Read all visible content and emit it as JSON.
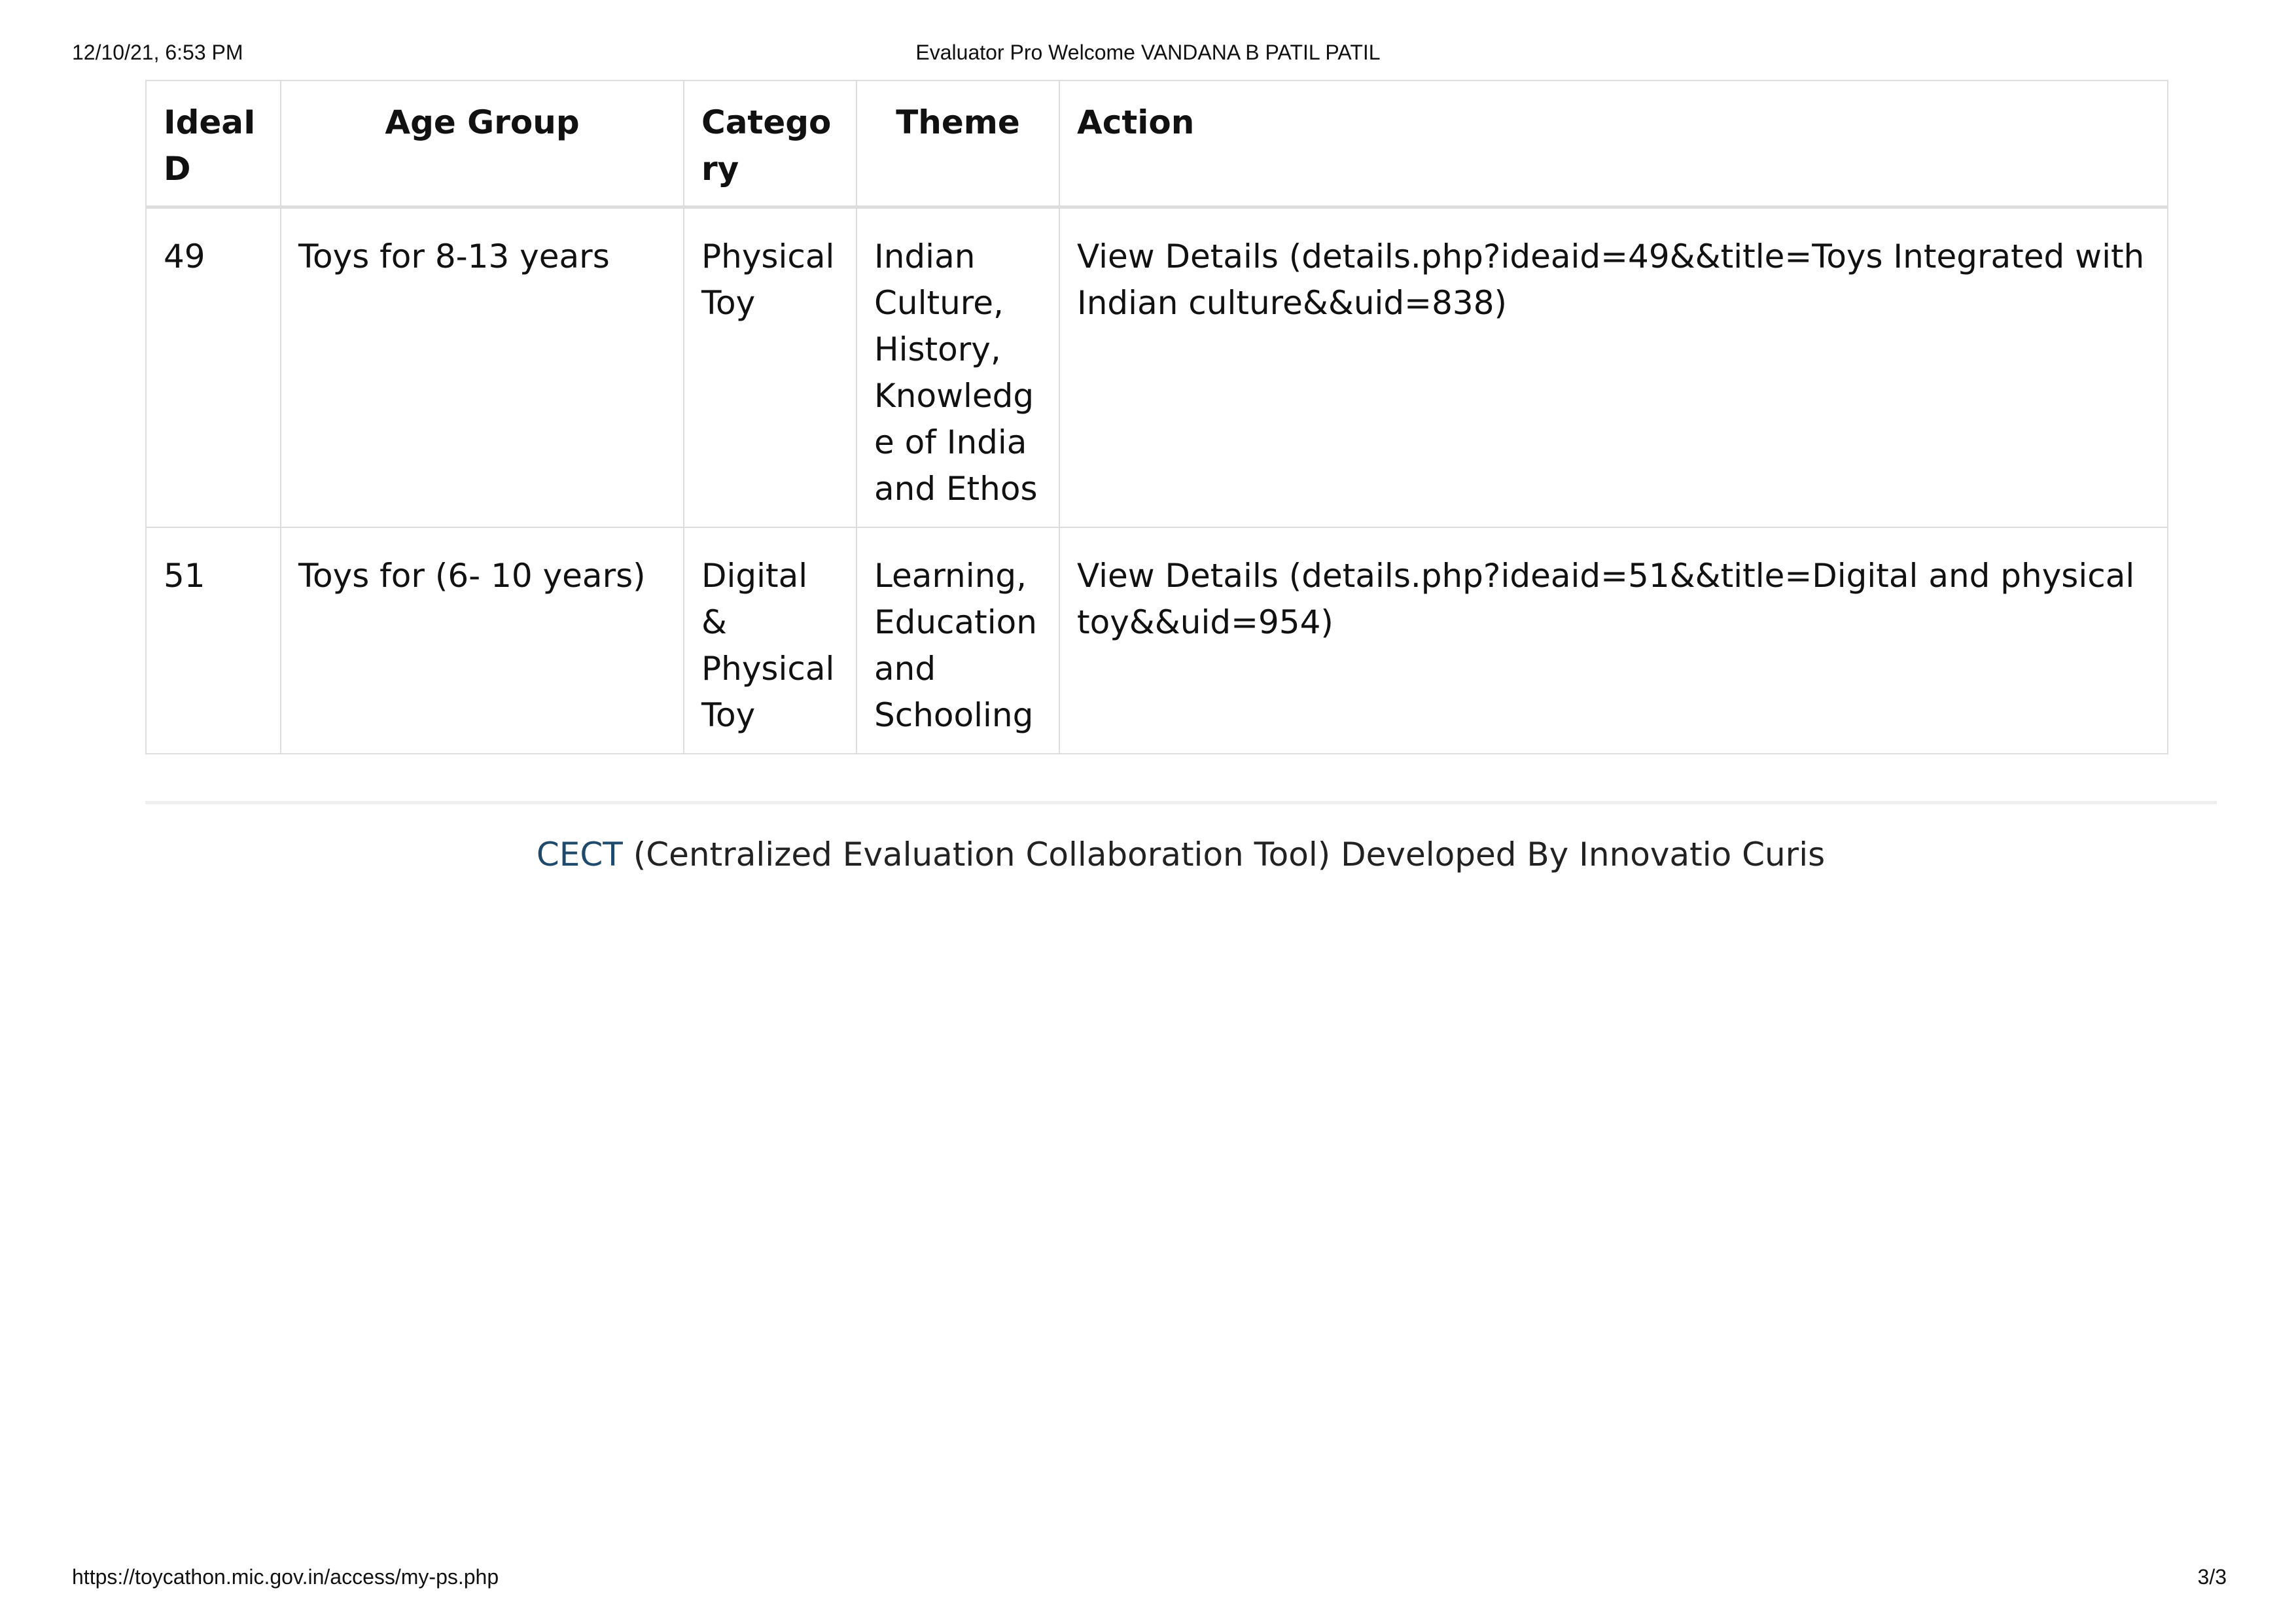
{
  "print_header": {
    "datetime": "12/10/21, 6:53 PM",
    "title": "Evaluator Pro Welcome VANDANA B PATIL PATIL"
  },
  "table": {
    "headers": {
      "idea_id": "IdeaID",
      "age_group": "Age Group",
      "category": "Category",
      "theme": "Theme",
      "action": "Action"
    },
    "rows": [
      {
        "idea_id": "49",
        "age_group": "Toys for 8-13 years",
        "category": "Physical Toy",
        "theme": "Indian Culture, History, Knowledge of India and Ethos",
        "action": "View Details (details.php?ideaid=49&&title=Toys Integrated with Indian culture&&uid=838)"
      },
      {
        "idea_id": "51",
        "age_group": "Toys for (6- 10 years)",
        "category": "Digital & Physical Toy",
        "theme": "Learning, Education and Schooling",
        "action": "View Details (details.php?ideaid=51&&title=Digital and physical toy&&uid=954)"
      }
    ]
  },
  "footer": {
    "brand": "CECT",
    "text": "(Centralized Evaluation Collaboration Tool) Developed By Innovatio Curis"
  },
  "print_footer": {
    "url": "https://toycathon.mic.gov.in/access/my-ps.php",
    "page": "3/3"
  },
  "colors": {
    "brand": "#1f4a6b",
    "border": "#dddddd"
  }
}
